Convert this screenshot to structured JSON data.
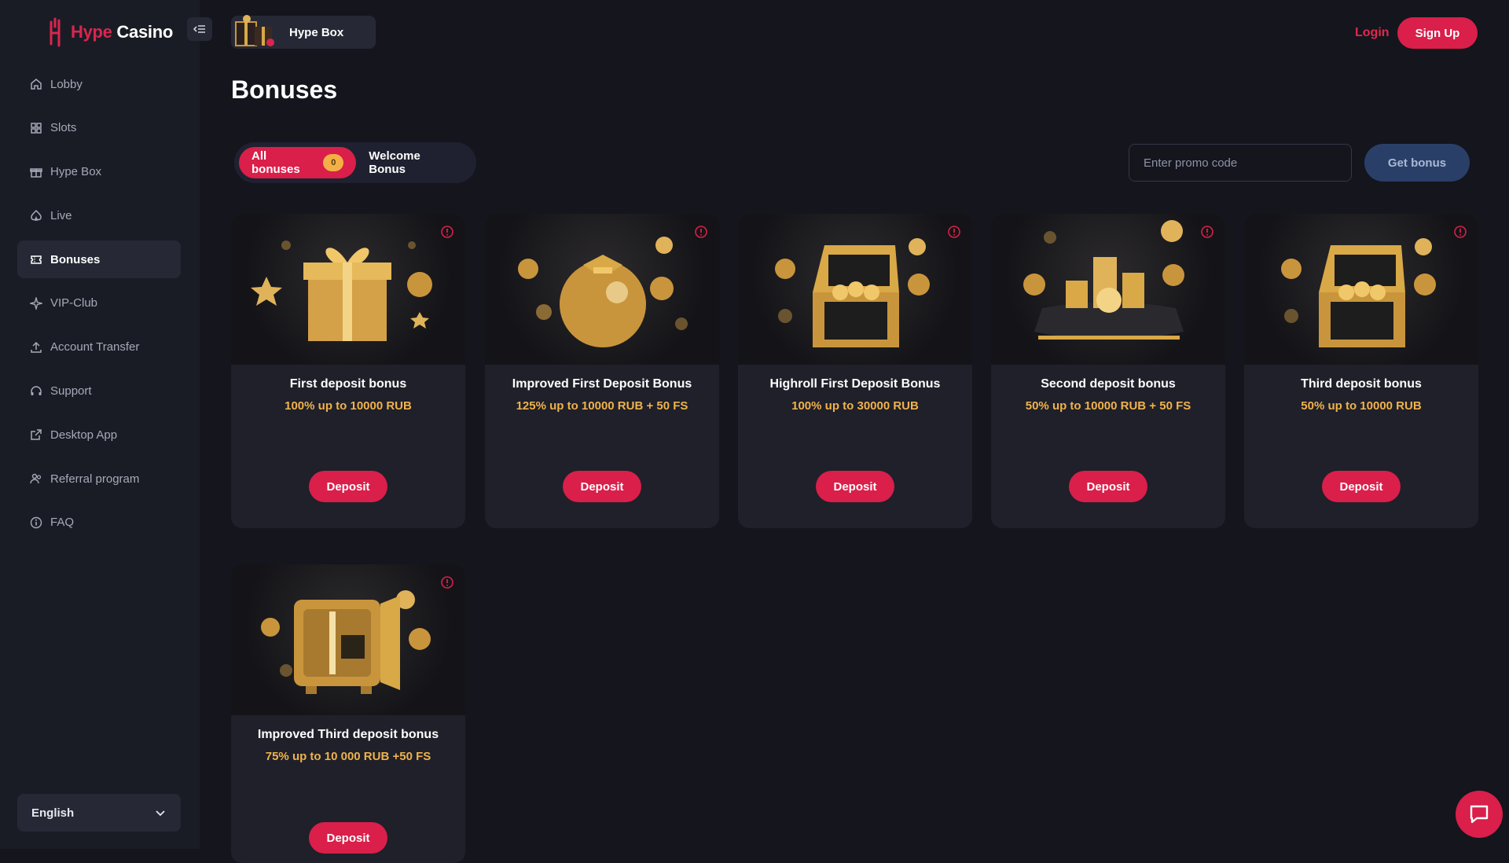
{
  "brand": {
    "name_part1": "Hype",
    "name_part2": " Casino",
    "color": "#d9264f"
  },
  "sidebar": {
    "items": [
      {
        "label": "Lobby",
        "icon": "home-icon"
      },
      {
        "label": "Slots",
        "icon": "grid-icon"
      },
      {
        "label": "Hype Box",
        "icon": "gift-icon"
      },
      {
        "label": "Live",
        "icon": "spade-icon"
      },
      {
        "label": "Bonuses",
        "icon": "ticket-icon",
        "active": true
      },
      {
        "label": "VIP-Club",
        "icon": "sparkle-icon"
      },
      {
        "label": "Account Transfer",
        "icon": "upload-icon"
      },
      {
        "label": "Support",
        "icon": "headset-icon"
      },
      {
        "label": "Desktop App",
        "icon": "external-link-icon"
      },
      {
        "label": "Referral program",
        "icon": "users-icon"
      },
      {
        "label": "FAQ",
        "icon": "info-icon"
      }
    ],
    "language": "English"
  },
  "header": {
    "hype_box": "Hype Box",
    "login": "Login",
    "signup": "Sign Up"
  },
  "page": {
    "title": "Bonuses"
  },
  "filters": {
    "all": "All bonuses",
    "all_count": "0",
    "welcome": "Welcome Bonus"
  },
  "promo": {
    "placeholder": "Enter promo code",
    "button": "Get bonus"
  },
  "cards": [
    {
      "title": "First deposit bonus",
      "subtitle": "100% up to 10000 RUB",
      "button": "Deposit",
      "art": "gift-box"
    },
    {
      "title": "Improved First Deposit Bonus",
      "subtitle": "125% up to 10000 RUB + 50 FS",
      "button": "Deposit",
      "art": "coin-bag"
    },
    {
      "title": "Highroll First Deposit Bonus",
      "subtitle": "100% up to 30000 RUB",
      "button": "Deposit",
      "art": "treasure-chest"
    },
    {
      "title": "Second deposit bonus",
      "subtitle": "50% up to 10000 RUB + 50 FS",
      "button": "Deposit",
      "art": "coin-cushion"
    },
    {
      "title": "Third deposit bonus",
      "subtitle": "50% up to 10000 RUB",
      "button": "Deposit",
      "art": "treasure-chest"
    },
    {
      "title": "Improved Third deposit bonus",
      "subtitle": "75% up to 10 000 RUB +50 FS",
      "button": "Deposit",
      "art": "safe"
    }
  ],
  "colors": {
    "accent": "#d91f4a",
    "gold": "#f0b24b",
    "background": "#14151d",
    "sidebar": "#1a1c25"
  }
}
